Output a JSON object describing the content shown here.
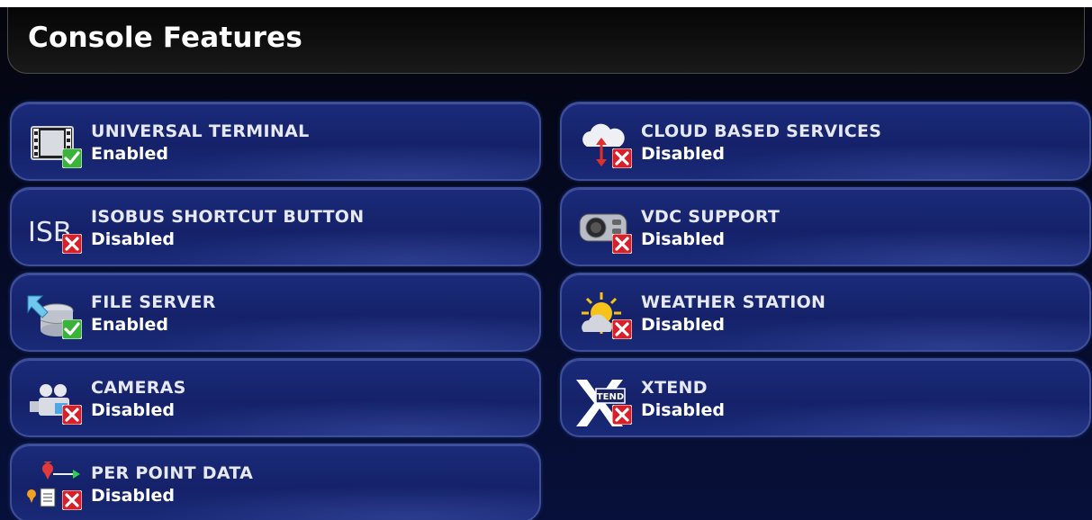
{
  "header": {
    "title": "Console Features"
  },
  "features": [
    {
      "name": "UNIVERSAL TERMINAL",
      "status": "Enabled",
      "icon": "universal-terminal-icon"
    },
    {
      "name": "ISOBUS SHORTCUT BUTTON",
      "status": "Disabled",
      "icon": "isobus-shortcut-icon",
      "icon_text": "ISB"
    },
    {
      "name": "FILE SERVER",
      "status": "Enabled",
      "icon": "file-server-icon"
    },
    {
      "name": "CAMERAS",
      "status": "Disabled",
      "icon": "camera-icon"
    },
    {
      "name": "PER POINT DATA",
      "status": "Disabled",
      "icon": "per-point-data-icon"
    },
    {
      "name": "CLOUD BASED SERVICES",
      "status": "Disabled",
      "icon": "cloud-services-icon"
    },
    {
      "name": "VDC SUPPORT",
      "status": "Disabled",
      "icon": "vdc-support-icon"
    },
    {
      "name": "WEATHER STATION",
      "status": "Disabled",
      "icon": "weather-station-icon"
    },
    {
      "name": "XTEND",
      "status": "Disabled",
      "icon": "xtend-icon",
      "icon_text": "TEND"
    }
  ],
  "colors": {
    "enabled_badge": "#3bb33b",
    "disabled_badge": "#d8202a",
    "tile_background": "#17256e",
    "screen_background": "#07103a"
  }
}
